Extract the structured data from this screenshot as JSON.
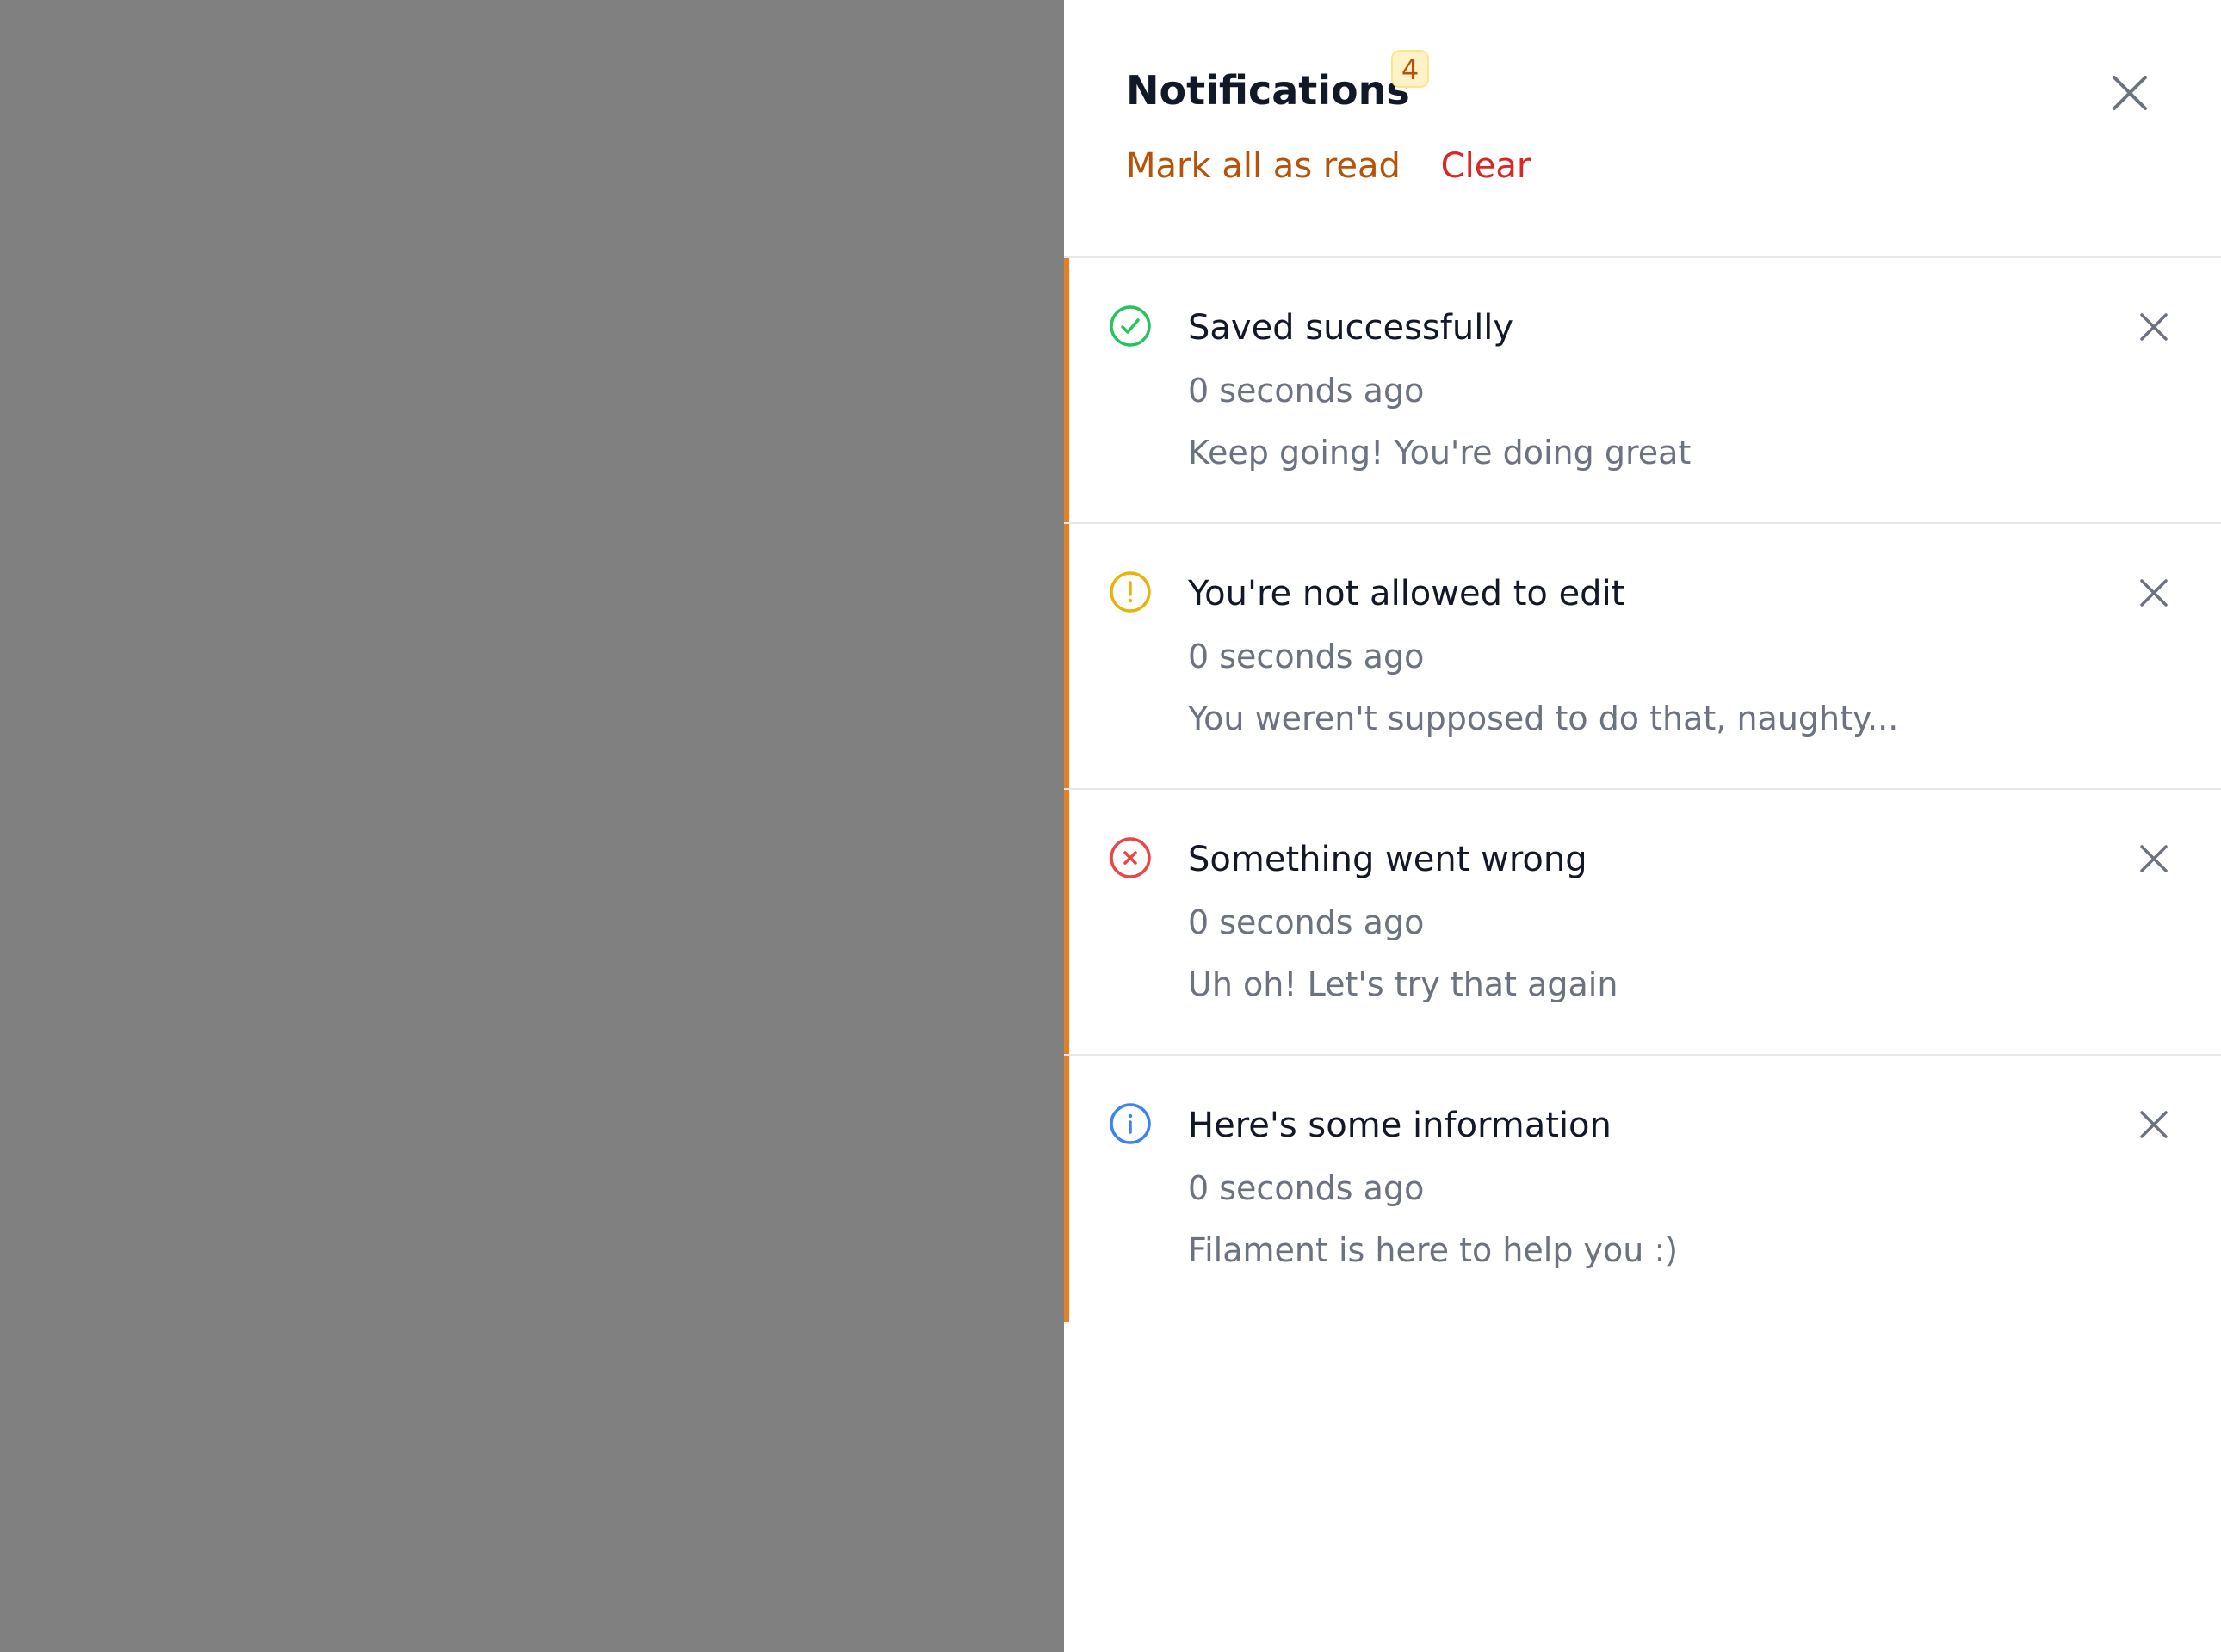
{
  "panel": {
    "title": "Notifications",
    "unread_count": "4",
    "mark_all_read_label": "Mark all as read",
    "clear_label": "Clear",
    "close_icon": "x-icon"
  },
  "notifications": [
    {
      "title": "Saved successfully",
      "time": "0 seconds ago",
      "body": "Keep going! You're doing great",
      "icon": "check-circle-icon",
      "color": "#22c55e"
    },
    {
      "title": "You're not allowed to edit",
      "time": "0 seconds ago",
      "body": "You weren't supposed to do that, naughty...",
      "icon": "exclamation-circle-icon",
      "color": "#eab308"
    },
    {
      "title": "Something went wrong",
      "time": "0 seconds ago",
      "body": "Uh oh! Let's try that again",
      "icon": "x-circle-icon",
      "color": "#ef4444"
    },
    {
      "title": "Here's some information",
      "time": "0 seconds ago",
      "body": "Filament is here to help you :)",
      "icon": "info-circle-icon",
      "color": "#3b82f6"
    }
  ],
  "colors": {
    "overlay": "#808080",
    "accent_bar": "#e67e22",
    "primary_action": "#b45309",
    "danger_action": "#dc2626"
  }
}
